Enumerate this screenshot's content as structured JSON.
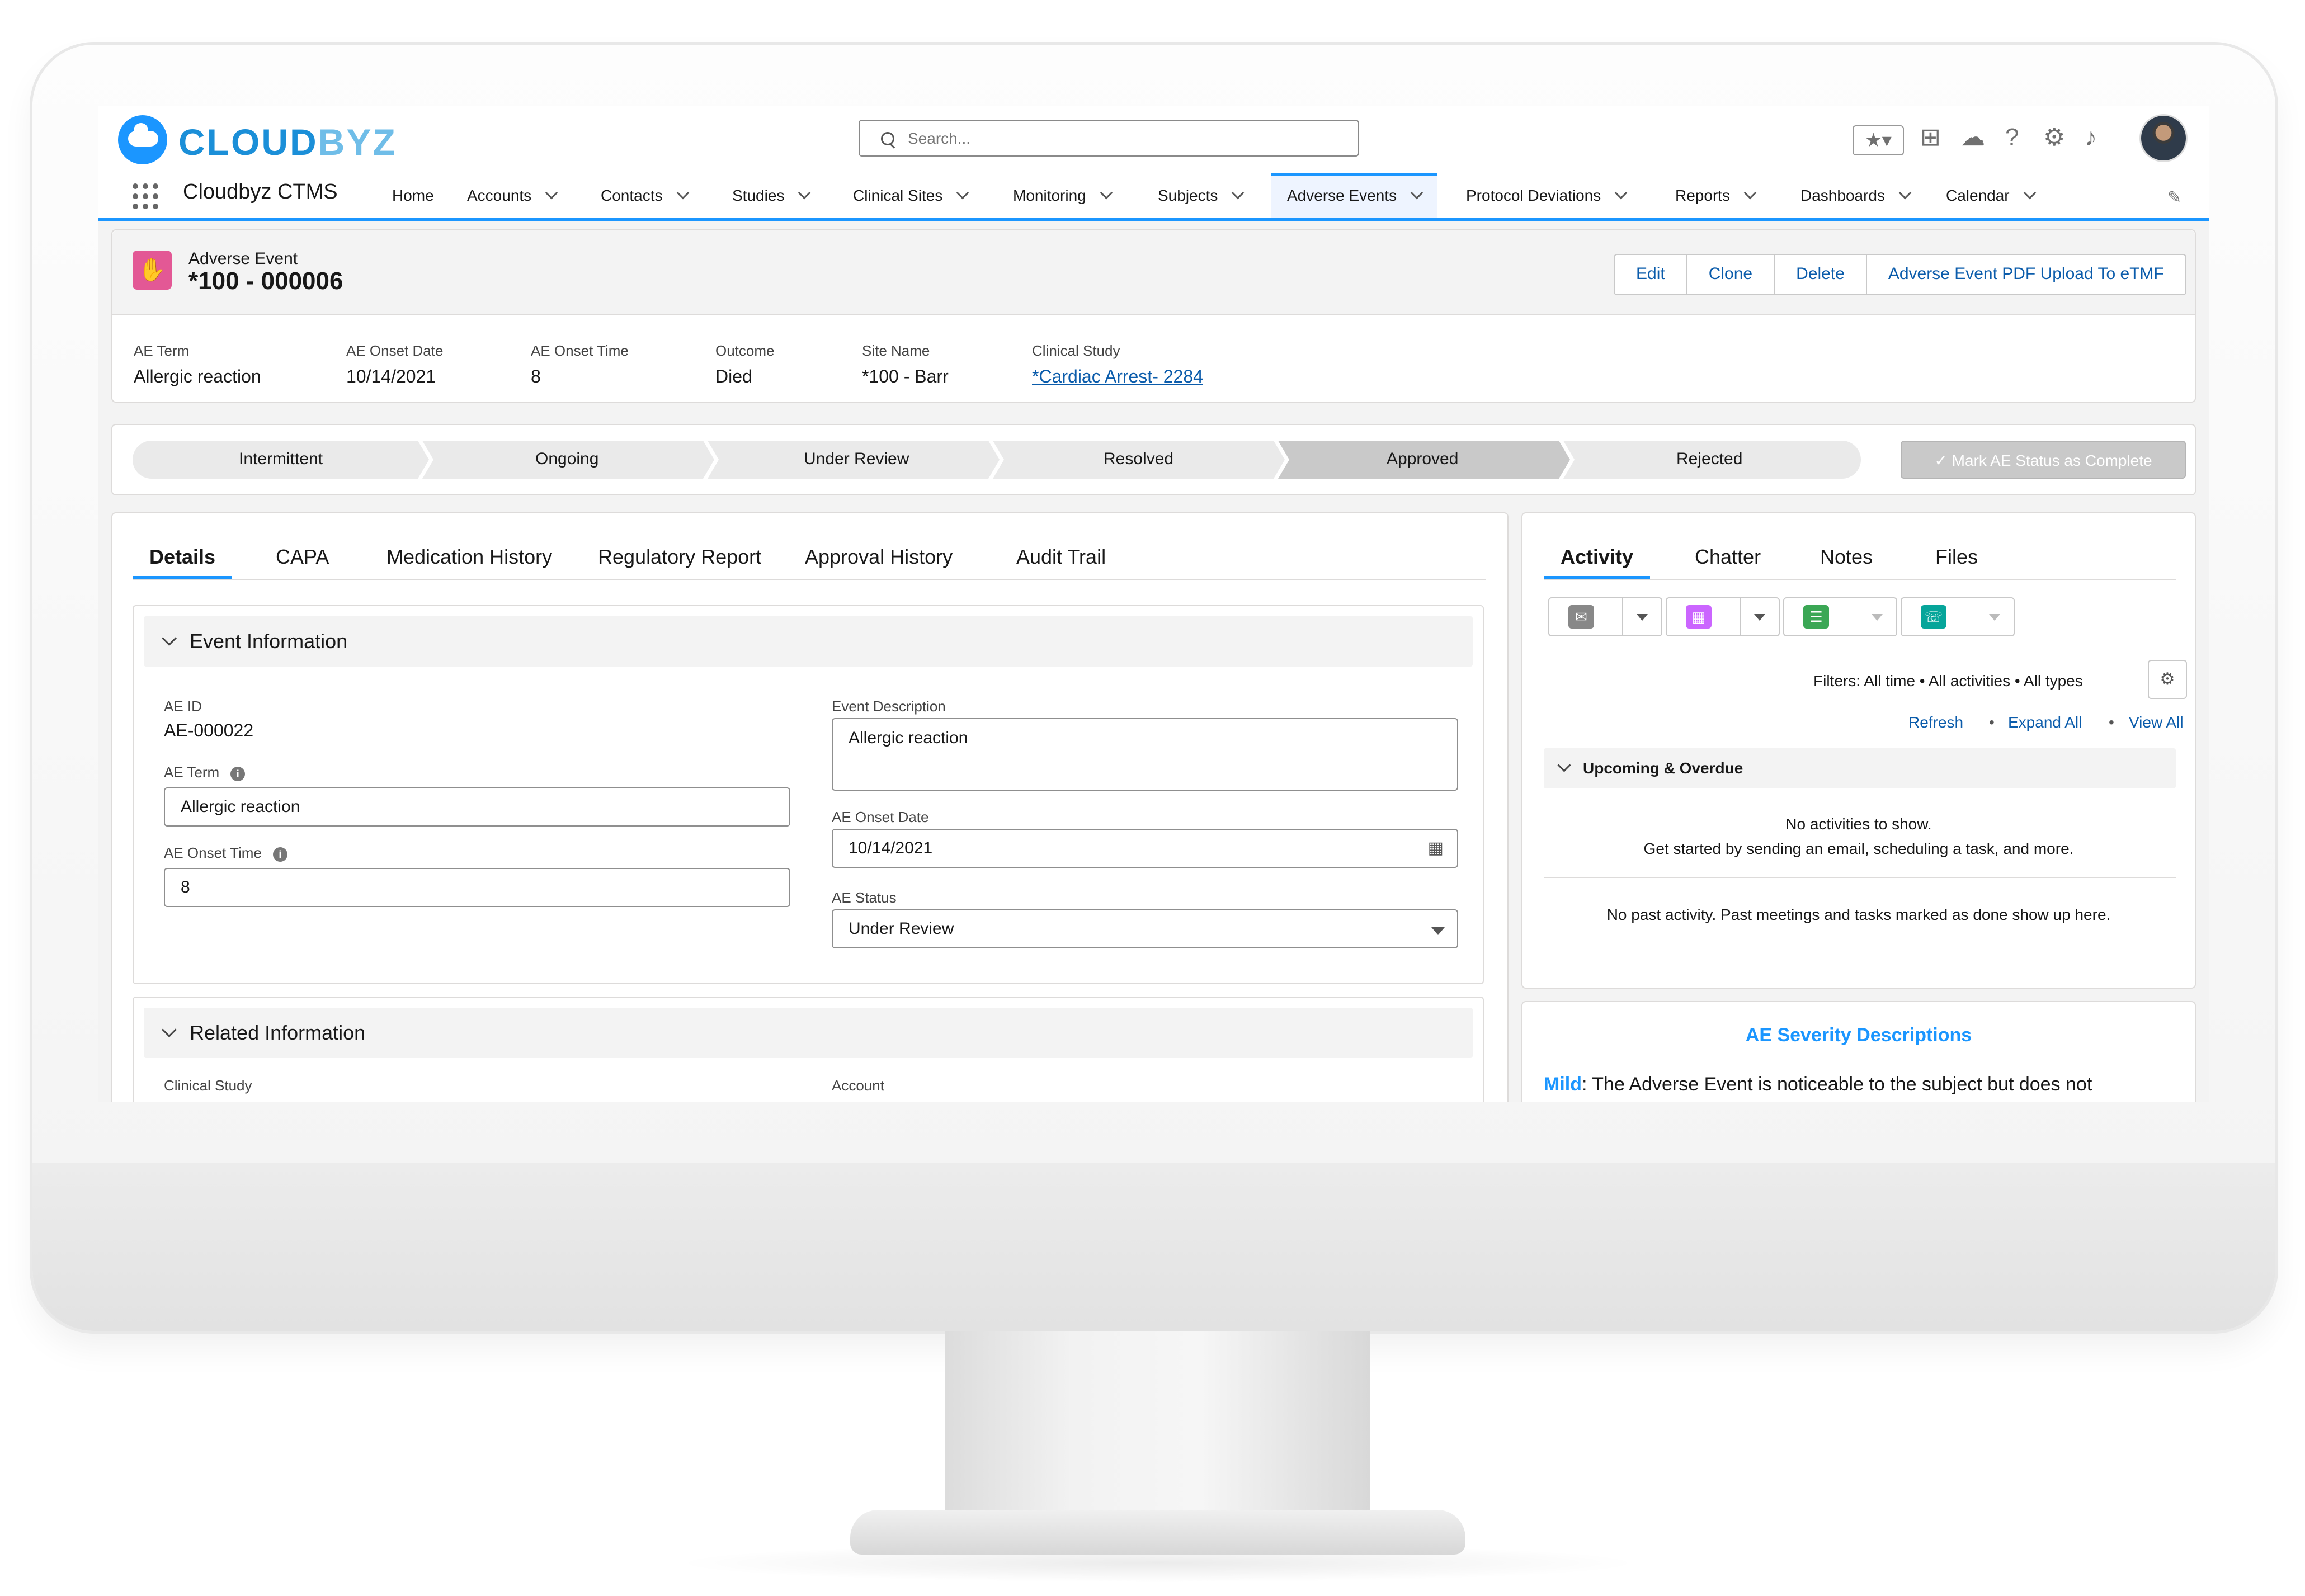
{
  "header": {
    "logo_part1": "CLOUD",
    "logo_part2": "BYZ",
    "search_placeholder": "Search..."
  },
  "nav": {
    "app_name": "Cloudbyz CTMS",
    "items": [
      {
        "label": "Home"
      },
      {
        "label": "Accounts"
      },
      {
        "label": "Contacts"
      },
      {
        "label": "Studies"
      },
      {
        "label": "Clinical Sites"
      },
      {
        "label": "Monitoring"
      },
      {
        "label": "Subjects"
      },
      {
        "label": "Adverse Events"
      },
      {
        "label": "Protocol Deviations"
      },
      {
        "label": "Reports"
      },
      {
        "label": "Dashboards"
      },
      {
        "label": "Calendar"
      }
    ]
  },
  "record": {
    "object_label": "Adverse Event",
    "name": "*100 - 000006",
    "actions": [
      "Edit",
      "Clone",
      "Delete",
      "Adverse Event PDF Upload To eTMF"
    ],
    "highlights": [
      {
        "label": "AE Term",
        "value": "Allergic reaction"
      },
      {
        "label": "AE Onset Date",
        "value": "10/14/2021"
      },
      {
        "label": "AE Onset Time",
        "value": "8"
      },
      {
        "label": "Outcome",
        "value": "Died"
      },
      {
        "label": "Site Name",
        "value": "*100 - Barr"
      },
      {
        "label": "Clinical Study",
        "value": "*Cardiac Arrest- 2284"
      }
    ]
  },
  "path": {
    "steps": [
      "Intermittent",
      "Ongoing",
      "Under Review",
      "Resolved",
      "Approved",
      "Rejected"
    ],
    "current_step": "Approved",
    "mark_button": "✓  Mark AE Status as Complete"
  },
  "detail": {
    "tabs": [
      "Details",
      "CAPA",
      "Medication History",
      "Regulatory Report",
      "Approval History",
      "Audit Trail"
    ],
    "event_section_title": "Event Information",
    "ae_id_label": "AE ID",
    "ae_id_value": "AE-000022",
    "ae_term_label": "AE Term",
    "ae_term_value": "Allergic reaction",
    "ae_onset_time_label": "AE Onset Time",
    "ae_onset_time_value": "8",
    "event_description_label": "Event Description",
    "event_description_value": "Allergic reaction",
    "ae_onset_date_label": "AE Onset Date",
    "ae_onset_date_value": "10/14/2021",
    "ae_status_label": "AE Status",
    "ae_status_value": "Under Review",
    "related_section_title": "Related Information",
    "clinical_study_label": "Clinical Study",
    "account_label": "Account"
  },
  "activity": {
    "tabs": [
      "Activity",
      "Chatter",
      "Notes",
      "Files"
    ],
    "filters_text": "Filters: All time • All activities • All types",
    "links": [
      "Refresh",
      "Expand All",
      "View All"
    ],
    "upcoming_title": "Upcoming & Overdue",
    "no_activities": "No activities to show.",
    "get_started": "Get started by sending an email, scheduling a task, and more.",
    "no_past": "No past activity. Past meetings and tasks marked as done show up here."
  },
  "severity": {
    "title": "AE Severity Descriptions",
    "mild_label": "Mild",
    "mild_text": ": The Adverse Event is noticeable to the subject but does not"
  },
  "colors": {
    "brand_blue": "#1b96ff",
    "link_blue": "#0b5cab",
    "ae_icon_pink": "#e35895"
  }
}
